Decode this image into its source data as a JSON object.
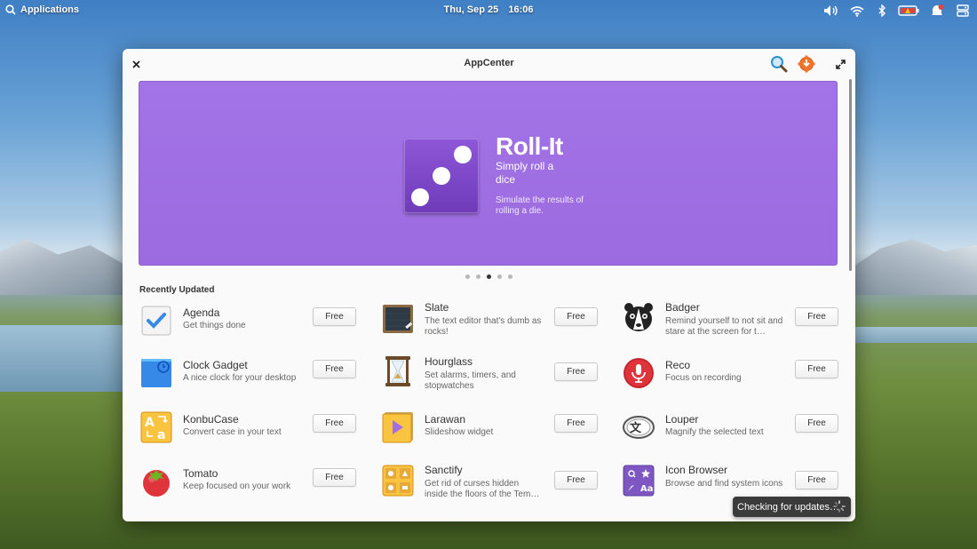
{
  "panel": {
    "applications_label": "Applications",
    "date": "Thu, Sep 25",
    "time": "16:06",
    "indicators": [
      "volume-icon",
      "wifi-icon",
      "bluetooth-icon",
      "battery-icon",
      "notifications-icon",
      "session-icon"
    ]
  },
  "window": {
    "title": "AppCenter"
  },
  "banner": {
    "app_name": "Roll-It",
    "tagline": "Simply roll a dice",
    "description": "Simulate the results of rolling a die.",
    "color": "#9c6bdf",
    "page_count": 5,
    "active_page": 3
  },
  "recently_updated": {
    "heading": "Recently Updated",
    "apps": [
      {
        "name": "Agenda",
        "summary": "Get things done",
        "price": "Free",
        "icon": "agenda-icon"
      },
      {
        "name": "Slate",
        "summary": "The text editor that's dumb as rocks!",
        "price": "Free",
        "icon": "slate-icon"
      },
      {
        "name": "Badger",
        "summary": "Remind yourself to not sit and stare at the screen for t…",
        "price": "Free",
        "icon": "badger-icon"
      },
      {
        "name": "Clock Gadget",
        "summary": "A nice clock for your desktop",
        "price": "Free",
        "icon": "clock-gadget-icon"
      },
      {
        "name": "Hourglass",
        "summary": "Set alarms, timers, and stopwatches",
        "price": "Free",
        "icon": "hourglass-icon"
      },
      {
        "name": "Reco",
        "summary": "Focus on recording",
        "price": "Free",
        "icon": "reco-icon"
      },
      {
        "name": "KonbuCase",
        "summary": "Convert case in your text",
        "price": "Free",
        "icon": "konbucase-icon"
      },
      {
        "name": "Larawan",
        "summary": "Slideshow widget",
        "price": "Free",
        "icon": "larawan-icon"
      },
      {
        "name": "Louper",
        "summary": "Magnify the selected text",
        "price": "Free",
        "icon": "louper-icon"
      },
      {
        "name": "Tomato",
        "summary": "Keep focused on your work",
        "price": "Free",
        "icon": "tomato-icon"
      },
      {
        "name": "Sanctify",
        "summary": "Get rid of curses hidden inside the floors of the Tem…",
        "price": "Free",
        "icon": "sanctify-icon"
      },
      {
        "name": "Icon Browser",
        "summary": "Browse and find system icons",
        "price": "Free",
        "icon": "icon-browser-icon"
      }
    ]
  },
  "toast": {
    "message": "Checking for updates…"
  }
}
